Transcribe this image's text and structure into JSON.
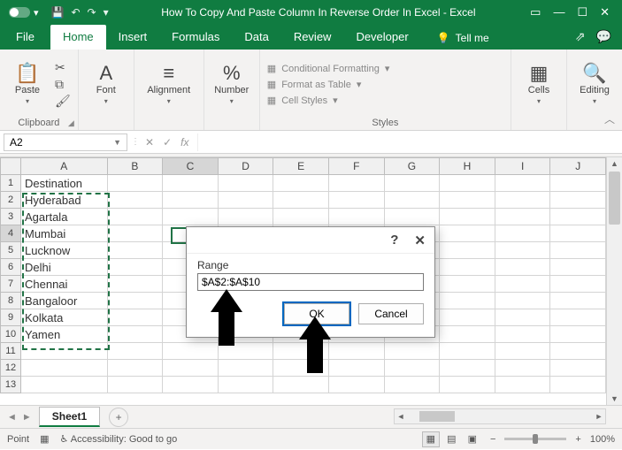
{
  "titlebar": {
    "title": "How To Copy And Paste Column In Reverse Order In Excel  -  Excel"
  },
  "tabs": {
    "file": "File",
    "list": [
      "Home",
      "Insert",
      "Formulas",
      "Data",
      "Review",
      "Developer"
    ],
    "active": "Home",
    "tellme": "Tell me"
  },
  "ribbon": {
    "clipboard": {
      "paste": "Paste",
      "label": "Clipboard"
    },
    "font": {
      "btn": "Font"
    },
    "alignment": {
      "btn": "Alignment"
    },
    "number": {
      "btn": "Number"
    },
    "styles": {
      "cf": "Conditional Formatting",
      "fat": "Format as Table",
      "cs": "Cell Styles",
      "label": "Styles"
    },
    "cells": {
      "btn": "Cells"
    },
    "editing": {
      "btn": "Editing"
    }
  },
  "formula_bar": {
    "namebox": "A2",
    "fx": "fx"
  },
  "grid": {
    "columns": [
      "A",
      "B",
      "C",
      "D",
      "E",
      "F",
      "G",
      "H",
      "I",
      "J"
    ],
    "row_count": 11,
    "cells_colA": [
      "Destination",
      "Hyderabad",
      "Agartala",
      "Mumbai",
      "Lucknow",
      "Delhi",
      "Chennai",
      "Bangaloor",
      "Kolkata",
      "Yamen"
    ],
    "active_cell_ref": "C4",
    "marching_ants_range": "A2:A10"
  },
  "dialog": {
    "range_label": "Range",
    "range_value": "$A$2:$A$10",
    "ok": "OK",
    "cancel": "Cancel",
    "help": "?",
    "close": "✕"
  },
  "sheettabs": {
    "sheet": "Sheet1",
    "add": "+"
  },
  "status": {
    "mode": "Point",
    "accessibility": "Accessibility: Good to go",
    "zoom": "100%",
    "minus": "−",
    "plus": "+"
  }
}
